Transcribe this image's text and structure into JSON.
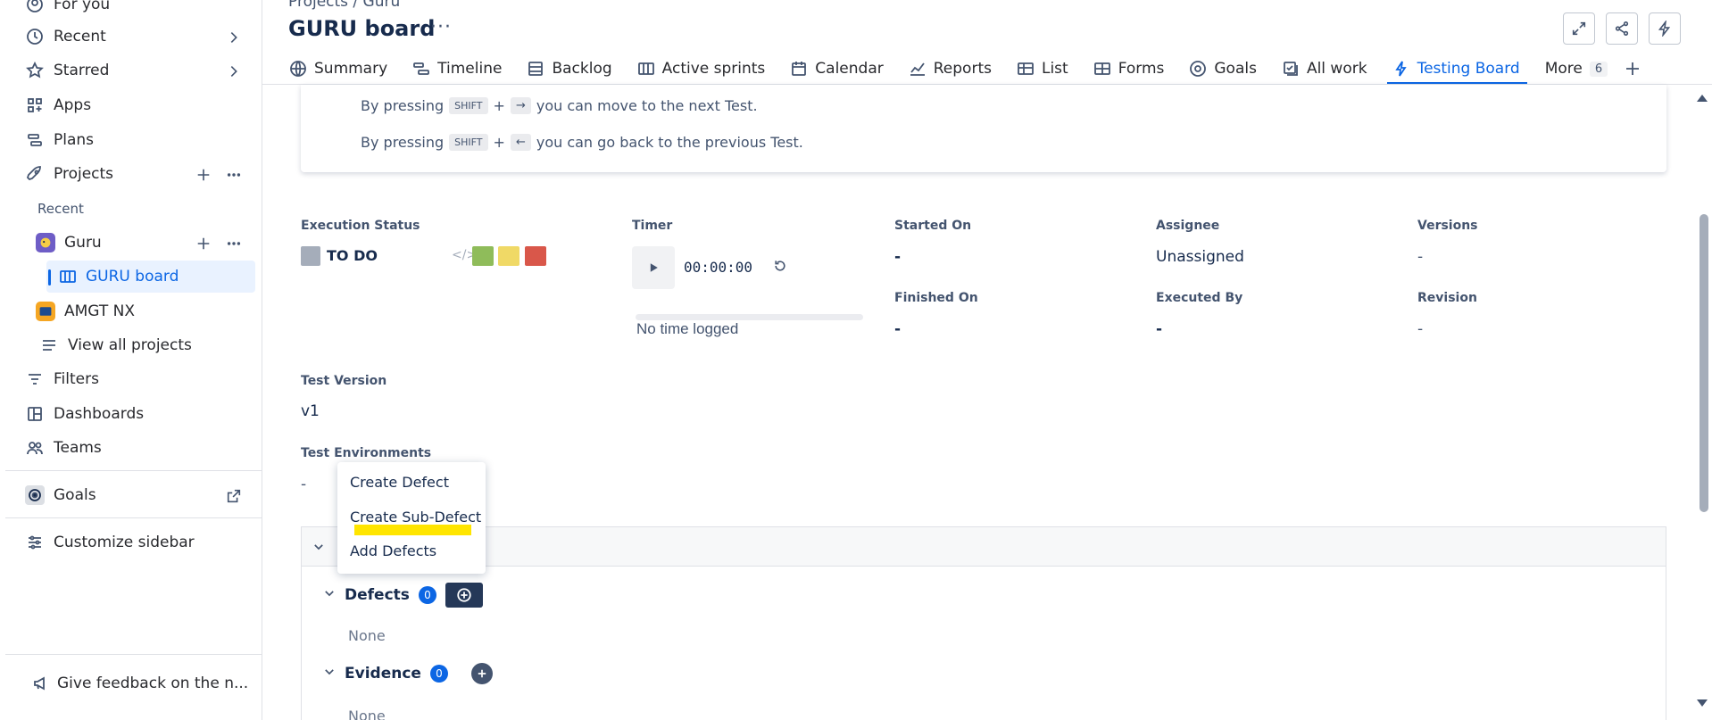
{
  "sidebar": {
    "for_you": "For you",
    "recent": "Recent",
    "starred": "Starred",
    "apps": "Apps",
    "plans": "Plans",
    "projects": "Projects",
    "recent_label": "Recent",
    "proj_guru": "Guru",
    "guru_board": "GURU board",
    "proj_amgt": "AMGT NX",
    "view_all": "View all projects",
    "filters": "Filters",
    "dashboards": "Dashboards",
    "teams": "Teams",
    "goals": "Goals",
    "customize": "Customize sidebar",
    "feedback": "Give feedback on the n..."
  },
  "header": {
    "breadcrumb": "Projects  /  Guru",
    "title": "GURU board",
    "more": "···"
  },
  "tabs": {
    "summary": "Summary",
    "timeline": "Timeline",
    "backlog": "Backlog",
    "active_sprints": "Active sprints",
    "calendar": "Calendar",
    "reports": "Reports",
    "list": "List",
    "forms": "Forms",
    "goals": "Goals",
    "all_work": "All work",
    "testing_board": "Testing Board",
    "more": "More",
    "more_count": "6"
  },
  "info": {
    "line1_pre": "By pressing",
    "line1_key": "SHIFT",
    "plus": "+",
    "line1_arrow": "→",
    "line1_post": "you can move to the next Test.",
    "line2_pre": "By pressing",
    "line2_key": "SHIFT",
    "line2_arrow": "←",
    "line2_post": "you can go back to the previous Test."
  },
  "fields": {
    "execution_status_label": "Execution Status",
    "execution_status_value": "TO DO",
    "timer_label": "Timer",
    "timer_value": "00:00:00",
    "timer_progress": 0,
    "no_time": "No time logged",
    "started_on_label": "Started On",
    "started_on_value": "-",
    "finished_on_label": "Finished On",
    "finished_on_value": "-",
    "assignee_label": "Assignee",
    "assignee_value": "Unassigned",
    "executed_by_label": "Executed By",
    "executed_by_value": "-",
    "versions_label": "Versions",
    "versions_value": "-",
    "revision_label": "Revision",
    "revision_value": "-",
    "test_version_label": "Test Version",
    "test_version_value": "v1",
    "test_env_label": "Test Environments",
    "test_env_value": "-"
  },
  "status_colors": {
    "gray": "#a5adba",
    "green": "#8fbc5a",
    "yellow": "#f0d966",
    "red": "#d9574a"
  },
  "context_menu": {
    "create_defect": "Create Defect",
    "create_sub_defect": "Create Sub-Defect",
    "add_defects": "Add Defects"
  },
  "defects": {
    "title": "Defects",
    "count": "0",
    "none": "None"
  },
  "evidence": {
    "title": "Evidence",
    "count": "0",
    "none": "None"
  }
}
